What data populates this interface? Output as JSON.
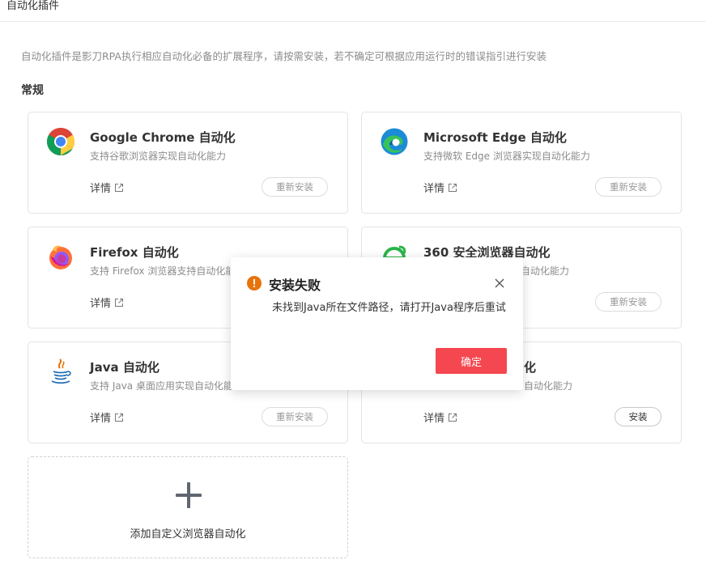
{
  "header": {
    "title": "自动化插件"
  },
  "description": "自动化插件是影刀RPA执行相应自动化必备的扩展程序，请按需安装，若不确定可根据应用运行时的错误指引进行安装",
  "section_title": "常规",
  "plugins": [
    {
      "name": "Google Chrome 自动化",
      "desc": "支持谷歌浏览器实现自动化能力",
      "detail": "详情",
      "action": "重新安装",
      "icon": "chrome-icon"
    },
    {
      "name": "Microsoft Edge 自动化",
      "desc": "支持微软 Edge 浏览器实现自动化能力",
      "detail": "详情",
      "action": "重新安装",
      "icon": "edge-icon"
    },
    {
      "name": "Firefox 自动化",
      "desc": "支持 Firefox 浏览器支持自动化能",
      "detail": "详情",
      "action": "",
      "icon": "firefox-icon"
    },
    {
      "name": "360 安全浏览器自动化",
      "desc": "现自动化能力",
      "detail": "详情",
      "action": "重新安装",
      "icon": "360-browser-icon"
    },
    {
      "name": "Java 自动化",
      "desc": "支持 Java 桌面应用实现自动化能",
      "detail": "详情",
      "action": "重新安装",
      "icon": "java-icon"
    },
    {
      "name": "化",
      "desc": "自动化能力",
      "detail": "详情",
      "action": "安装",
      "icon": ""
    }
  ],
  "add_custom": {
    "label": "添加自定义浏览器自动化",
    "icon": "plus-icon"
  },
  "dialog": {
    "title": "安装失败",
    "message": "未找到Java所在文件路径，请打开Java程序后重试",
    "confirm_label": "确定",
    "icon": "warning-icon",
    "close_icon": "close-icon",
    "accent_color": "#f5474f",
    "warning_color": "#e8730b"
  }
}
